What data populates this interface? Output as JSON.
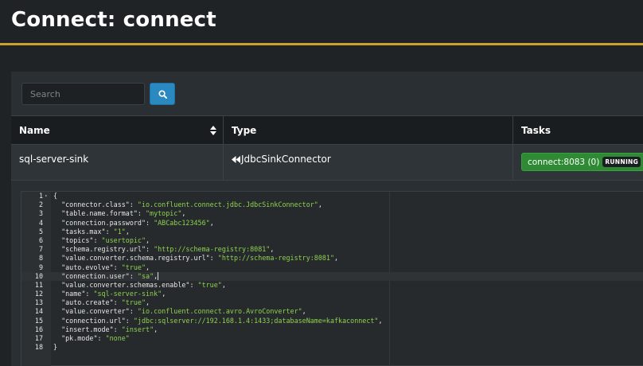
{
  "page": {
    "title": "Connect: connect"
  },
  "search": {
    "placeholder": "Search",
    "button_icon": "search-icon"
  },
  "colors": {
    "accent": "#c8a42e",
    "primary": "#2b89c2",
    "success": "#2e8b34",
    "json_string": "#8fd14f"
  },
  "table": {
    "columns": [
      "Name",
      "Type",
      "Tasks"
    ],
    "rows": [
      {
        "name": "sql-server-sink",
        "type": "JdbcSinkConnector",
        "type_icon": "backward-icon",
        "task_label": "connect:8083 (0)",
        "task_status": "RUNNING"
      }
    ]
  },
  "editor": {
    "active_line": 10,
    "lines": [
      {
        "n": "1",
        "text": "{"
      },
      {
        "n": "2",
        "key": "connector.class",
        "value": "io.confluent.connect.jdbc.JdbcSinkConnector"
      },
      {
        "n": "3",
        "key": "table.name.format",
        "value": "mytopic"
      },
      {
        "n": "4",
        "key": "connection.password",
        "value": "ABCabc123456"
      },
      {
        "n": "5",
        "key": "tasks.max",
        "value": "1"
      },
      {
        "n": "6",
        "key": "topics",
        "value": "usertopic"
      },
      {
        "n": "7",
        "key": "schema.registry.url",
        "value": "http://schema-registry:8081"
      },
      {
        "n": "8",
        "key": "value.converter.schema.registry.url",
        "value": "http://schema-registry:8081"
      },
      {
        "n": "9",
        "key": "auto.evolve",
        "value": "true"
      },
      {
        "n": "10",
        "key": "connection.user",
        "value": "sa"
      },
      {
        "n": "11",
        "key": "value.converter.schemas.enable",
        "value": "true"
      },
      {
        "n": "12",
        "key": "name",
        "value": "sql-server-sink"
      },
      {
        "n": "13",
        "key": "auto.create",
        "value": "true"
      },
      {
        "n": "14",
        "key": "value.converter",
        "value": "io.confluent.connect.avro.AvroConverter"
      },
      {
        "n": "15",
        "key": "connection.url",
        "value": "jdbc:sqlserver://192.168.1.4:1433;databaseName=kafkaconnect"
      },
      {
        "n": "16",
        "key": "insert.mode",
        "value": "insert"
      },
      {
        "n": "17",
        "key": "pk.mode",
        "value": "none",
        "last": true
      },
      {
        "n": "18",
        "text": "}"
      }
    ]
  }
}
